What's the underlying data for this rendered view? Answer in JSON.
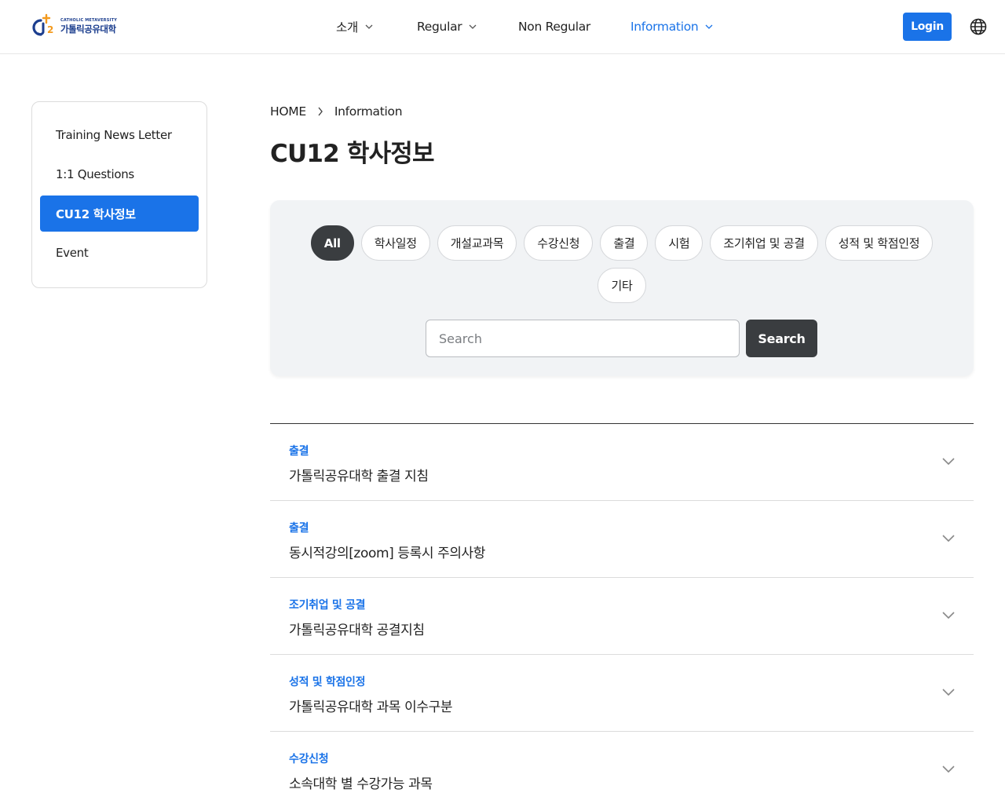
{
  "header": {
    "logo": {
      "small_text": "CATHOLIC METAVERSITY",
      "main_text": "가톨릭공유대학",
      "mark_text": "CU12"
    },
    "nav": [
      {
        "label": "소개",
        "has_dropdown": true,
        "active": false
      },
      {
        "label": "Regular",
        "has_dropdown": true,
        "active": false
      },
      {
        "label": "Non Regular",
        "has_dropdown": false,
        "active": false
      },
      {
        "label": "Information",
        "has_dropdown": true,
        "active": true
      }
    ],
    "login_label": "Login",
    "language_icon": "globe-icon"
  },
  "sidebar": {
    "items": [
      {
        "label": "Training News Letter",
        "active": false
      },
      {
        "label": "1:1 Questions",
        "active": false
      },
      {
        "label": "CU12 학사정보",
        "active": true
      },
      {
        "label": "Event",
        "active": false
      }
    ]
  },
  "breadcrumb": {
    "home": "HOME",
    "current": "Information"
  },
  "page_title": "CU12 학사정보",
  "filters": {
    "chips": [
      {
        "label": "All",
        "active": true
      },
      {
        "label": "학사일정",
        "active": false
      },
      {
        "label": "개설교과목",
        "active": false
      },
      {
        "label": "수강신청",
        "active": false
      },
      {
        "label": "출결",
        "active": false
      },
      {
        "label": "시험",
        "active": false
      },
      {
        "label": "조기취업 및 공결",
        "active": false
      },
      {
        "label": "성적 및 학점인정",
        "active": false
      },
      {
        "label": "기타",
        "active": false
      }
    ],
    "search_placeholder": "Search",
    "search_value": "",
    "search_button": "Search"
  },
  "list": [
    {
      "category": "출결",
      "title": "가톨릭공유대학 출결 지침"
    },
    {
      "category": "출결",
      "title": "동시적강의[zoom] 등록시 주의사항"
    },
    {
      "category": "조기취업 및 공결",
      "title": "가톨릭공유대학 공결지침"
    },
    {
      "category": "성적 및 학점인정",
      "title": "가톨릭공유대학 과목 이수구분"
    },
    {
      "category": "수강신청",
      "title": "소속대학 별 수강가능 과목"
    }
  ],
  "colors": {
    "accent": "#1a73e8",
    "dark": "#3a3d40",
    "panel": "#f1f3f5",
    "logo_orange": "#f39a1e",
    "logo_navy": "#1d3f8f"
  }
}
